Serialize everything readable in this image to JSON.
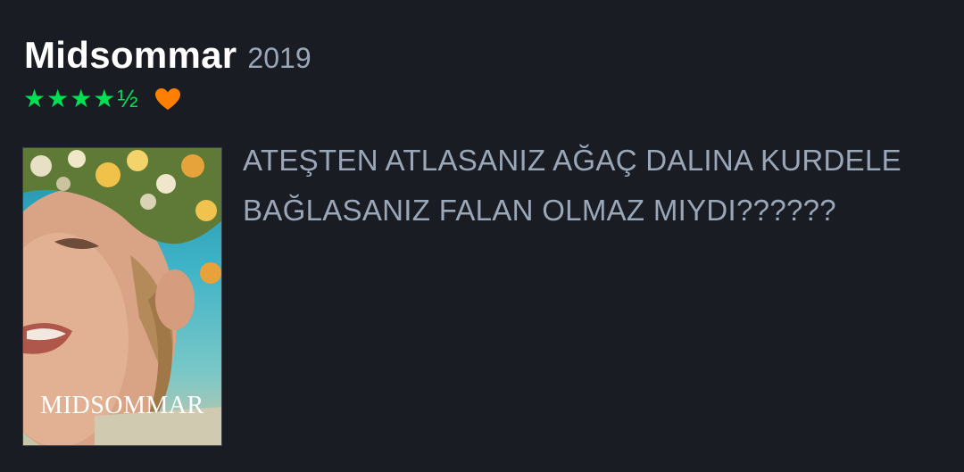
{
  "film": {
    "title": "Midsommar",
    "year": "2019"
  },
  "rating": {
    "stars": "★★★★",
    "half": "½",
    "star_color": "#00e054",
    "liked": true,
    "heart_color": "#ff8000",
    "heart_icon": "heart-icon"
  },
  "poster": {
    "title": "MIDSOMMAR"
  },
  "review": {
    "line1": "ATEŞTEN ATLASANIZ AĞAÇ DALINA KURDELE",
    "line2": "BAĞLASANIZ FALAN OLMAZ MIYDI??????"
  },
  "colors": {
    "background": "#191c22",
    "title": "#ffffff",
    "muted": "#9aa7b8"
  }
}
